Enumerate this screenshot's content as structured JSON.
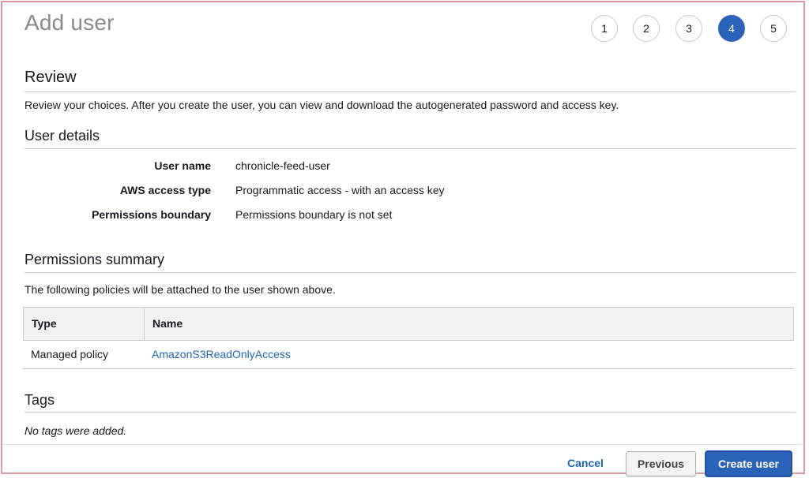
{
  "page": {
    "title": "Add user"
  },
  "steps": [
    {
      "label": "1",
      "active": false
    },
    {
      "label": "2",
      "active": false
    },
    {
      "label": "3",
      "active": false
    },
    {
      "label": "4",
      "active": true
    },
    {
      "label": "5",
      "active": false
    }
  ],
  "review": {
    "title": "Review",
    "description": "Review your choices. After you create the user, you can view and download the autogenerated password and access key."
  },
  "user_details": {
    "title": "User details",
    "rows": [
      {
        "label": "User name",
        "value": "chronicle-feed-user"
      },
      {
        "label": "AWS access type",
        "value": "Programmatic access - with an access key"
      },
      {
        "label": "Permissions boundary",
        "value": "Permissions boundary is not set"
      }
    ]
  },
  "permissions_summary": {
    "title": "Permissions summary",
    "description": "The following policies will be attached to the user shown above.",
    "columns": [
      "Type",
      "Name"
    ],
    "rows": [
      {
        "type": "Managed policy",
        "name": "AmazonS3ReadOnlyAccess"
      }
    ]
  },
  "tags": {
    "title": "Tags",
    "empty_text": "No tags were added."
  },
  "footer": {
    "cancel_label": "Cancel",
    "previous_label": "Previous",
    "create_label": "Create user"
  },
  "colors": {
    "accent": "#2a63b8",
    "link": "#1f66b8",
    "frame_border": "#d99aa3"
  }
}
